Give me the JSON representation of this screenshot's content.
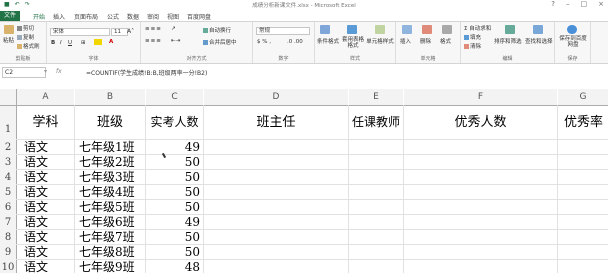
{
  "window": {
    "title": "成绩分析新课文件.xlsx - Microsoft Excel",
    "controls": [
      "?",
      "–",
      "□",
      "×"
    ]
  },
  "quick_access": [
    "save-icon",
    "undo-icon",
    "redo-icon"
  ],
  "ribbon_tabs": [
    "文件",
    "开始",
    "插入",
    "页面布局",
    "公式",
    "数据",
    "审阅",
    "视图",
    "百度网盘"
  ],
  "ribbon": {
    "clipboard": {
      "paste": "粘贴",
      "cut": "剪切",
      "copy": "复制",
      "format_painter": "格式刷",
      "label": "剪贴板"
    },
    "font": {
      "name": "宋体",
      "size": "11",
      "bold": "B",
      "italic": "I",
      "underline": "U",
      "label": "字体"
    },
    "alignment": {
      "wrap": "自动换行",
      "merge": "合并后居中",
      "label": "对齐方式"
    },
    "number": {
      "format": "常规",
      "label": "数字"
    },
    "styles": {
      "conditional": "条件格式",
      "table": "套用表格格式",
      "cell_styles": "单元格样式",
      "label": "样式"
    },
    "cells": {
      "insert": "插入",
      "delete": "删除",
      "format": "格式",
      "label": "单元格"
    },
    "editing": {
      "autosum": "自动求和",
      "fill": "填充",
      "clear": "清除",
      "sort": "排序和筛选",
      "find": "查找和选择",
      "label": "编辑"
    },
    "save": {
      "label": "保存到百度网盘",
      "group": "保存"
    }
  },
  "formula_bar": {
    "name_box": "C2",
    "fx": "fx",
    "formula": "=COUNTIF(学生成绩!B:B,班级两率一分!B2)"
  },
  "columns": [
    "A",
    "B",
    "C",
    "D",
    "E",
    "F",
    "G"
  ],
  "rows": [
    "1",
    "2",
    "3",
    "4",
    "5",
    "6",
    "7",
    "8",
    "9",
    "10"
  ],
  "header_row": [
    "学科",
    "班级",
    "实考人数",
    "班主任",
    "任课教师",
    "优秀人数",
    "优秀率"
  ],
  "data_rows": [
    {
      "subject": "语文",
      "class": "七年级1班",
      "count": "49"
    },
    {
      "subject": "语文",
      "class": "七年级2班",
      "count": "50"
    },
    {
      "subject": "语文",
      "class": "七年级3班",
      "count": "50"
    },
    {
      "subject": "语文",
      "class": "七年级4班",
      "count": "50"
    },
    {
      "subject": "语文",
      "class": "七年级5班",
      "count": "50"
    },
    {
      "subject": "语文",
      "class": "七年级6班",
      "count": "49"
    },
    {
      "subject": "语文",
      "class": "七年级7班",
      "count": "50"
    },
    {
      "subject": "语文",
      "class": "七年级8班",
      "count": "50"
    },
    {
      "subject": "语文",
      "class": "七年级9班",
      "count": "48"
    }
  ],
  "colors": {
    "accent": "#217346"
  }
}
